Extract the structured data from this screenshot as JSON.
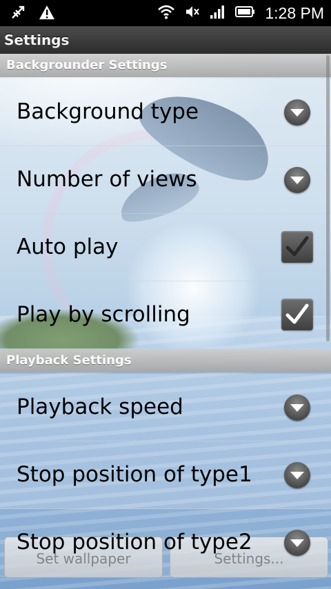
{
  "status_bar": {
    "time": "1:28 PM",
    "left_icons": [
      "usb-debug-icon",
      "warning-icon"
    ],
    "right_icons": [
      "wifi-icon",
      "mute-icon",
      "signal-icon",
      "battery-icon"
    ]
  },
  "title": "Settings",
  "sections": [
    {
      "header": "Backgrounder Settings",
      "items": [
        {
          "label": "Background type",
          "widget": "dropdown"
        },
        {
          "label": "Number of views",
          "widget": "dropdown"
        },
        {
          "label": "Auto play",
          "widget": "checkbox",
          "checked": true,
          "enabled": false
        },
        {
          "label": "Play by scrolling",
          "widget": "checkbox",
          "checked": true,
          "enabled": true
        }
      ]
    },
    {
      "header": "Playback Settings",
      "items": [
        {
          "label": "Playback speed",
          "widget": "dropdown"
        },
        {
          "label": "Stop position of type1",
          "widget": "dropdown"
        },
        {
          "label": "Stop position of type2",
          "widget": "dropdown"
        }
      ]
    }
  ],
  "bottom_buttons": {
    "set_wallpaper": "Set wallpaper",
    "settings": "Settings..."
  },
  "colors": {
    "status_bar": "#000000",
    "title_bar": "#3a3a3a",
    "section_header": "#bdbdbd",
    "label_text": "#000000"
  }
}
